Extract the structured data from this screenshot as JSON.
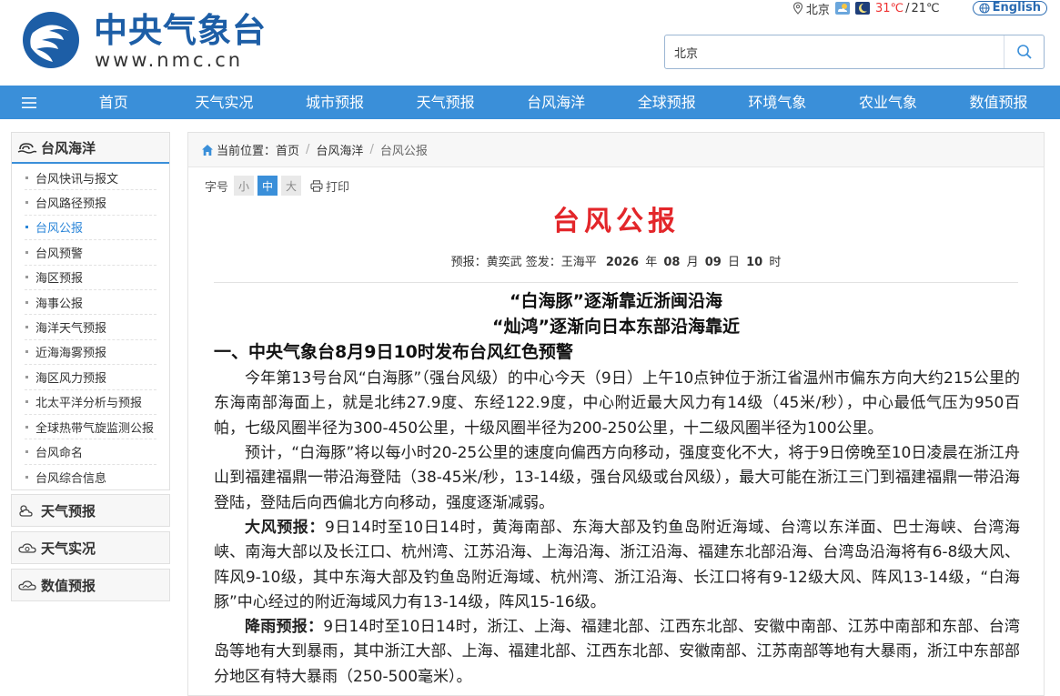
{
  "header": {
    "logo_title": "中央气象台",
    "logo_url": "www.nmc.cn",
    "city": "北京",
    "temp_high": "31℃",
    "temp_sep": "/",
    "temp_low": "21℃",
    "english_label": "English",
    "search_value": "北京"
  },
  "nav": {
    "items": [
      "首页",
      "天气实况",
      "城市预报",
      "天气预报",
      "台风海洋",
      "全球预报",
      "环境气象",
      "农业气象",
      "数值预报"
    ]
  },
  "sidebar": {
    "active_section": "台风海洋",
    "items": [
      "台风快讯与报文",
      "台风路径预报",
      "台风公报",
      "台风预警",
      "海区预报",
      "海事公报",
      "海洋天气预报",
      "近海海雾预报",
      "海区风力预报",
      "北太平洋分析与预报",
      "全球热带气旋监测公报",
      "台风命名",
      "台风综合信息"
    ],
    "active_item": "台风公报",
    "other_sections": [
      "天气预报",
      "天气实况",
      "数值预报"
    ]
  },
  "breadcrumb": {
    "label": "当前位置：",
    "items": [
      "首页",
      "台风海洋",
      "台风公报"
    ]
  },
  "tools": {
    "font_label": "字号",
    "small": "小",
    "medium": "中",
    "large": "大",
    "print": "打印"
  },
  "article": {
    "title": "台风公报",
    "byline_prefix": "预报：黄奕武  签发：王海平",
    "year": "2026",
    "year_unit": "年",
    "month": "08",
    "month_unit": "月",
    "day": "09",
    "day_unit": "日",
    "hour": "10",
    "hour_unit": "时",
    "subtitle1": "“白海豚”逐渐靠近浙闽沿海",
    "subtitle2": "“灿鸿”逐渐向日本东部沿海靠近",
    "section1": "一、中央气象台8月9日10时发布台风红色预警",
    "p1": "今年第13号台风“白海豚”（强台风级）的中心今天（9日）上午10点钟位于浙江省温州市偏东方向大约215公里的东海南部海面上，就是北纬27.9度、东经122.9度，中心附近最大风力有14级（45米/秒），中心最低气压为950百帕，七级风圈半径为300-450公里，十级风圈半径为200-250公里，十二级风圈半径为100公里。",
    "p2": "预计，“白海豚”将以每小时20-25公里的速度向偏西方向移动，强度变化不大，将于9日傍晚至10日凌晨在浙江舟山到福建福鼎一带沿海登陆（38-45米/秒，13-14级，强台风级或台风级），最大可能在浙江三门到福建福鼎一带沿海登陆，登陆后向西偏北方向移动，强度逐渐减弱。",
    "p3_label": "大风预报：",
    "p3": "9日14时至10日14时，黄海南部、东海大部及钓鱼岛附近海域、台湾以东洋面、巴士海峡、台湾海峡、南海大部以及长江口、杭州湾、江苏沿海、上海沿海、浙江沿海、福建东北部沿海、台湾岛沿海将有6-8级大风、阵风9-10级，其中东海大部及钓鱼岛附近海域、杭州湾、浙江沿海、长江口将有9-12级大风、阵风13-14级，“白海豚”中心经过的附近海域风力有13-14级，阵风15-16级。",
    "p4_label": "降雨预报：",
    "p4": "9日14时至10日14时，浙江、上海、福建北部、江西东北部、安徽中南部、江苏中南部和东部、台湾岛等地有大到暴雨，其中浙江大部、上海、福建北部、江西东北部、安徽南部、江苏南部等地有大暴雨，浙江中东部部分地区有特大暴雨（250-500毫米）。"
  },
  "colors": {
    "nav_blue": "#3a8fd9",
    "logo_blue": "#1d5ea6",
    "title_red": "#e3262a"
  }
}
